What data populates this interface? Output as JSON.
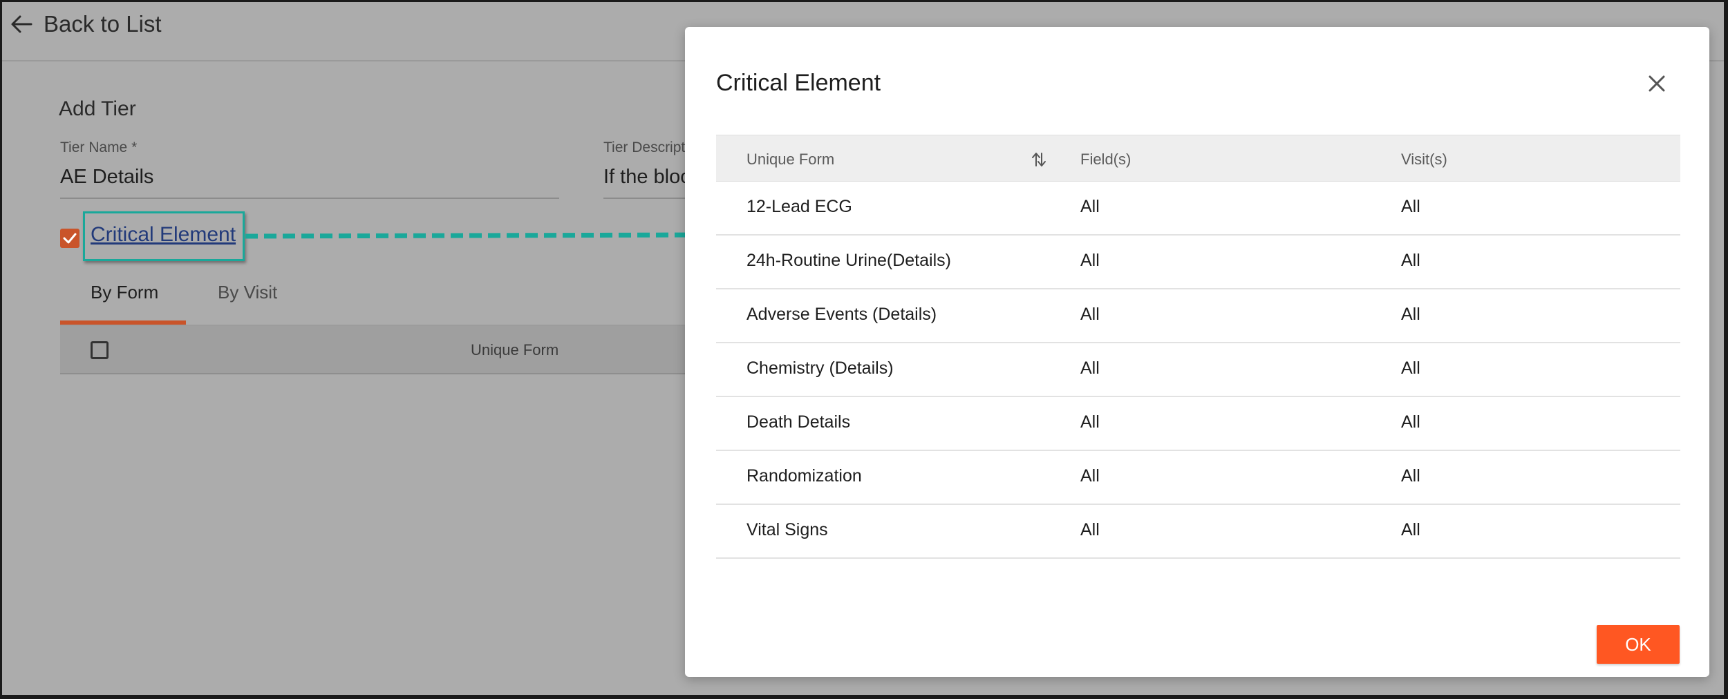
{
  "header": {
    "back_label": "Back to List"
  },
  "form": {
    "section_title": "Add Tier",
    "tier_name_label": "Tier Name *",
    "tier_name_value": "AE Details",
    "tier_desc_label": "Tier Description",
    "tier_desc_value": "If the blood",
    "critical_element_link": "Critical Element",
    "critical_element_checked": true
  },
  "tabs": [
    {
      "label": "By Form",
      "active": true
    },
    {
      "label": "By Visit",
      "active": false
    }
  ],
  "background_table": {
    "column_header": "Unique Form"
  },
  "modal": {
    "title": "Critical Element",
    "columns": [
      "Unique Form",
      "Field(s)",
      "Visit(s)"
    ],
    "rows": [
      {
        "form": "12-Lead ECG",
        "fields": "All",
        "visits": "All"
      },
      {
        "form": "24h-Routine Urine(Details)",
        "fields": "All",
        "visits": "All"
      },
      {
        "form": "Adverse Events (Details)",
        "fields": "All",
        "visits": "All"
      },
      {
        "form": "Chemistry (Details)",
        "fields": "All",
        "visits": "All"
      },
      {
        "form": "Death Details",
        "fields": "All",
        "visits": "All"
      },
      {
        "form": "Randomization",
        "fields": "All",
        "visits": "All"
      },
      {
        "form": "Vital Signs",
        "fields": "All",
        "visits": "All"
      }
    ],
    "ok_label": "OK"
  },
  "icons": {
    "back": "arrow-left-icon",
    "close": "close-icon",
    "sort": "sort-icon",
    "check": "check-icon"
  },
  "colors": {
    "accent": "#ff5722",
    "annotation": "#1aa89a",
    "link": "#223a7a"
  }
}
